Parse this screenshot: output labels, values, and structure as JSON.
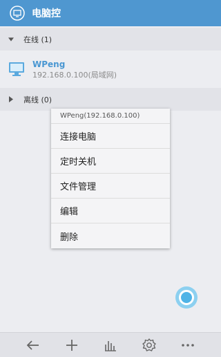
{
  "app": {
    "title": "电脑控",
    "accent": "#4f97d0"
  },
  "groups": [
    {
      "label": "在线 (1)",
      "expanded": true
    },
    {
      "label": "离线 (0)",
      "expanded": false
    }
  ],
  "device": {
    "name": "WPeng",
    "address": "192.168.0.100(局域网)"
  },
  "context_menu": {
    "header": "WPeng(192.168.0.100)",
    "items": [
      "连接电脑",
      "定时关机",
      "文件管理",
      "编辑",
      "删除"
    ]
  },
  "bottom_bar": {
    "icons": [
      "back-arrow-icon",
      "plus-icon",
      "bar-chart-icon",
      "gear-icon",
      "more-icon"
    ]
  }
}
